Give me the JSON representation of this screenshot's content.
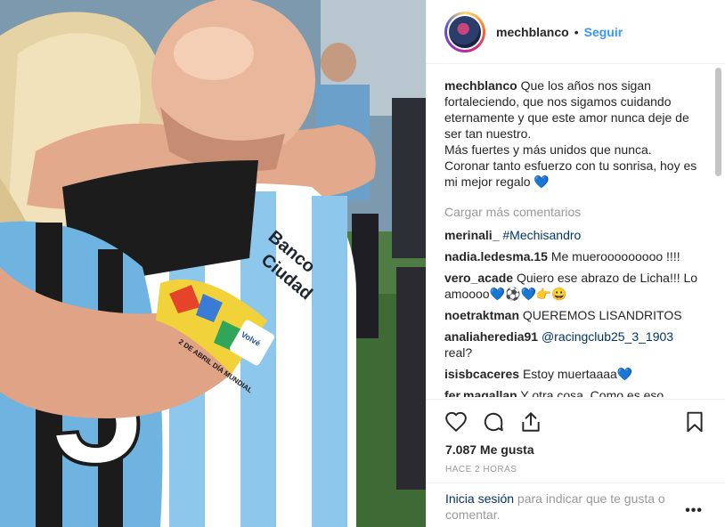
{
  "post": {
    "username": "mechblanco",
    "separator": "•",
    "follow_label": "Seguir",
    "caption_username": "mechblanco",
    "caption_text": "Que los años nos sigan fortaleciendo, que nos sigamos cuidando eternamente y que este amor nunca deje de ser tan nuestro.\nMás fuertes y más unidos que nunca.\nCoronar tanto esfuerzo con tu sonrisa, hoy es mi mejor regalo 💙",
    "load_more_label": "Cargar más comentarios",
    "comments": [
      {
        "user": "merinali_",
        "text": "",
        "link": "#Mechisandro"
      },
      {
        "user": "nadia.ledesma.15",
        "text": "Me muerooooooooo !!!!",
        "link": ""
      },
      {
        "user": "vero_acade",
        "text": "Quiero ese abrazo de Licha!!! Lo amoooo💙⚽💙👉😀",
        "link": ""
      },
      {
        "user": "noetraktman",
        "text": "QUEREMOS LISANDRITOS",
        "link": ""
      },
      {
        "user": "analiaheredia91",
        "text": "real?",
        "link": "@racingclub25_3_1903"
      },
      {
        "user": "isisbcaceres",
        "text": "Estoy muertaaaa💙",
        "link": ""
      },
      {
        "user": "fer.magallan",
        "text": "Y otra cosa. Como es eso",
        "link": ""
      }
    ],
    "likes_label": "7.087 Me gusta",
    "timestamp": "HACE 2 HORAS",
    "login_link": "Inicia sesión",
    "login_text": " para indicar que te gusta o comentar.",
    "more_label": "•••",
    "icons": {
      "like": "heart-icon",
      "comment": "comment-icon",
      "share": "share-icon",
      "save": "bookmark-icon"
    },
    "photo_jersey_text": "Banco Ciudad",
    "photo_armband_text": "2 DE ABRIL DÍA MUNDIAL",
    "photo_armband_badge": "Volvé a la vida"
  },
  "colors": {
    "accent": "#3897f0",
    "link": "#003569",
    "muted": "#999999",
    "text": "#262626"
  }
}
